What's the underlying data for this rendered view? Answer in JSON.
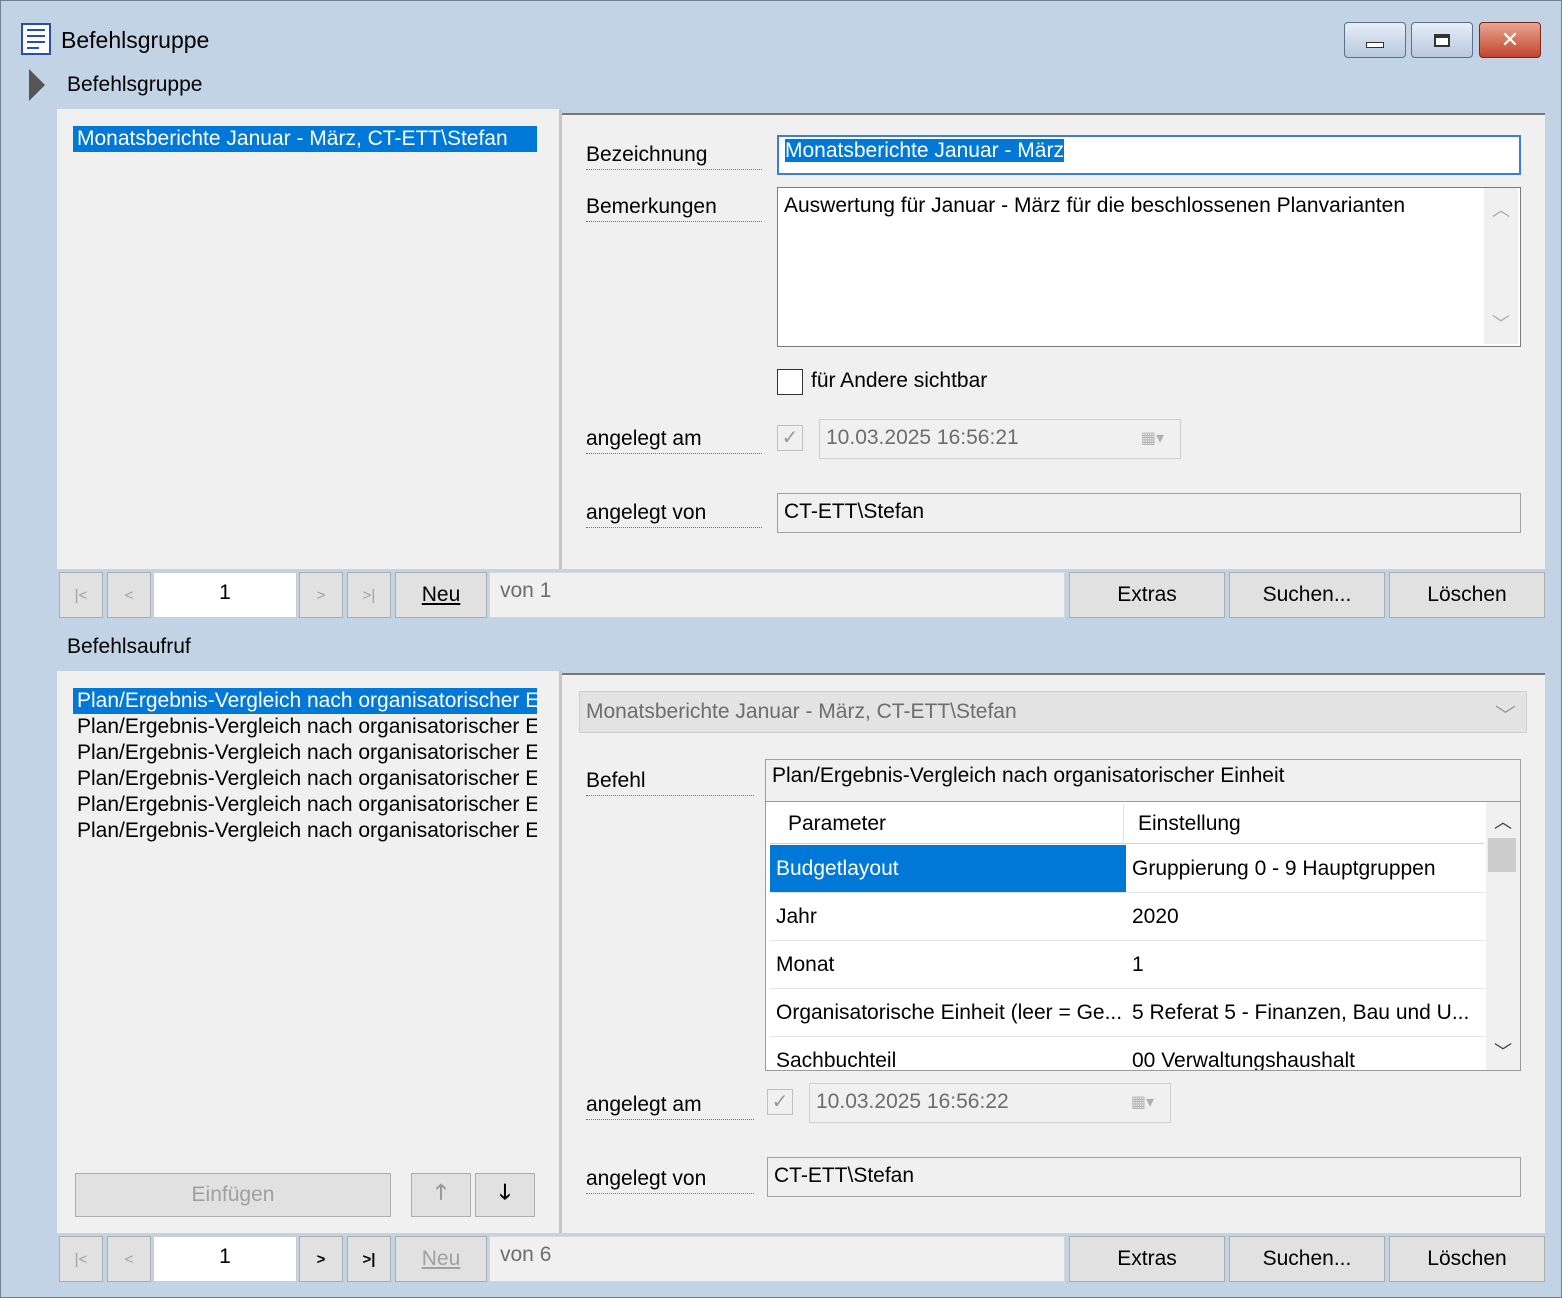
{
  "window": {
    "title": "Befehlsgruppe",
    "buttons": {
      "minimize": "minimize-icon",
      "restore": "restore-icon",
      "close": "close-icon"
    }
  },
  "group": {
    "header": "Befehlsgruppe",
    "list": [
      "Monatsberichte Januar - März, CT-ETT\\Stefan"
    ],
    "form": {
      "bezeichnung_label": "Bezeichnung",
      "bezeichnung_value": "Monatsberichte Januar - März",
      "bemerkungen_label": "Bemerkungen",
      "bemerkungen_value": "Auswertung für Januar - März für die beschlossenen Planvarianten",
      "sichtbar_label": "für Andere sichtbar",
      "angelegt_am_label": "angelegt am",
      "angelegt_am_value": "10.03.2025 16:56:21",
      "angelegt_von_label": "angelegt von",
      "angelegt_von_value": "CT-ETT\\Stefan"
    },
    "nav": {
      "first": "|<",
      "prev": "<",
      "page": "1",
      "next": ">",
      "last": ">|",
      "neu": "Neu",
      "von": "von 1",
      "extras": "Extras",
      "suchen": "Suchen...",
      "loeschen": "Löschen"
    }
  },
  "aufruf": {
    "header": "Befehlsaufruf",
    "list": [
      "Plan/Ergebnis-Vergleich nach organisatorischer Einheit",
      "Plan/Ergebnis-Vergleich nach organisatorischer Einheit",
      "Plan/Ergebnis-Vergleich nach organisatorischer Einheit",
      "Plan/Ergebnis-Vergleich nach organisatorischer Einheit",
      "Plan/Ergebnis-Vergleich nach organisatorischer Einheit",
      "Plan/Ergebnis-Vergleich nach organisatorischer Einheit"
    ],
    "einfuegen": "Einfügen",
    "up_icon": "arrow-up-icon",
    "down_icon": "arrow-down-icon",
    "group_select": "Monatsberichte Januar - März, CT-ETT\\Stefan",
    "befehl_label": "Befehl",
    "befehl_value": "Plan/Ergebnis-Vergleich nach organisatorischer Einheit",
    "grid": {
      "col_param": "Parameter",
      "col_setting": "Einstellung",
      "rows": [
        {
          "param": "Budgetlayout",
          "value": "Gruppierung 0 - 9 Hauptgruppen"
        },
        {
          "param": "Jahr",
          "value": "2020"
        },
        {
          "param": "Monat",
          "value": "1"
        },
        {
          "param": "Organisatorische Einheit (leer = Ge...",
          "value": "5 Referat 5 - Finanzen, Bau und U..."
        },
        {
          "param": "Sachbuchteil",
          "value": "00 Verwaltungshaushalt"
        }
      ]
    },
    "angelegt_am_label": "angelegt am",
    "angelegt_am_value": "10.03.2025 16:56:22",
    "angelegt_von_label": "angelegt von",
    "angelegt_von_value": "CT-ETT\\Stefan",
    "nav": {
      "first": "|<",
      "prev": "<",
      "page": "1",
      "next": ">",
      "last": ">|",
      "neu": "Neu",
      "von": "von 6",
      "extras": "Extras",
      "suchen": "Suchen...",
      "loeschen": "Löschen"
    }
  },
  "colors": {
    "selection": "#0078d7",
    "frame": "#c3d3e6",
    "panel": "#f0f0f0"
  }
}
